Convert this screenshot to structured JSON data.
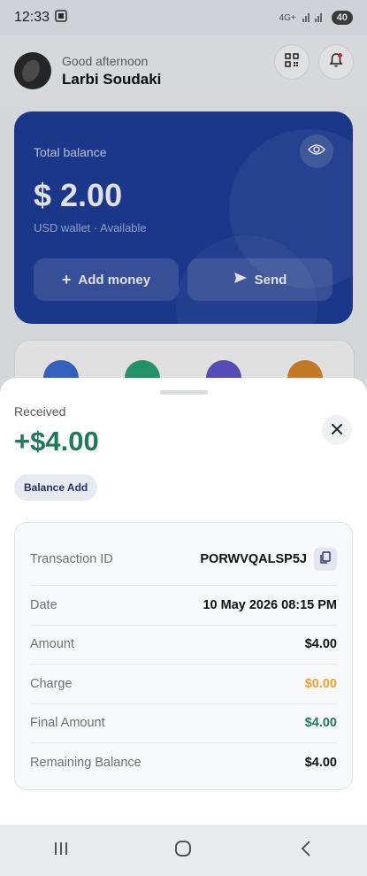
{
  "status": {
    "time": "12:33",
    "network": "4G+",
    "battery": "40"
  },
  "header": {
    "greeting": "Good afternoon",
    "name": "Larbi Soudaki"
  },
  "card": {
    "title": "Total balance",
    "balance": "$ 2.00",
    "subtitle": "USD wallet · Available",
    "add_money": "Add money",
    "send": "Send"
  },
  "sheet": {
    "label": "Received",
    "amount": "+$4.00",
    "badge": "Balance Add",
    "rows": [
      {
        "label": "Transaction ID",
        "value": "PORWVQALSP5J"
      },
      {
        "label": "Date",
        "value": "10 May 2026 08:15 PM"
      },
      {
        "label": "Amount",
        "value": "$4.00"
      },
      {
        "label": "Charge",
        "value": "$0.00"
      },
      {
        "label": "Final Amount",
        "value": "$4.00"
      },
      {
        "label": "Remaining Balance",
        "value": "$4.00"
      }
    ]
  },
  "colors": {
    "accent_green": "#1f7a5a",
    "charge_orange": "#f0a030",
    "card_blue": "#1f3f9e"
  },
  "icons": [
    "qr-scan-icon",
    "bell-icon",
    "eye-icon",
    "plus-icon",
    "send-icon",
    "close-icon",
    "copy-icon",
    "recents-icon",
    "home-icon",
    "back-icon"
  ]
}
